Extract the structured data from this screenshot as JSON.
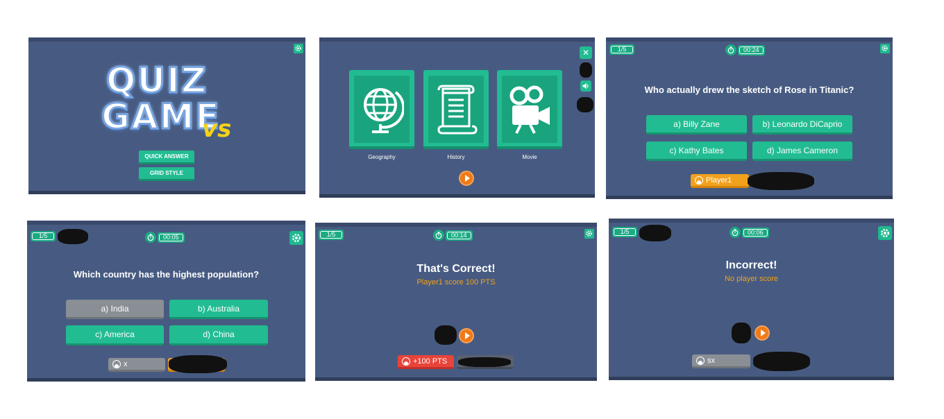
{
  "title_screen": {
    "logo_line1": "QUIZ",
    "logo_line2": "GAME",
    "logo_vs": "vs",
    "quick_answer": "QUICK ANSWER",
    "grid_style": "GRID STYLE"
  },
  "category_screen": {
    "categories": [
      {
        "label": "Geography",
        "icon": "globe-icon"
      },
      {
        "label": "History",
        "icon": "scroll-icon"
      },
      {
        "label": "Movie",
        "icon": "movie-camera-icon"
      }
    ],
    "close_label": "✕"
  },
  "question_screen_1": {
    "progress": "1/5",
    "timer": "00:24",
    "question": "Who actually drew the sketch of Rose in Titanic?",
    "answers": [
      "a) Billy Zane",
      "b) Leonardo DiCaprio",
      "c) Kathy Bates",
      "d) James Cameron"
    ],
    "player": "Player1"
  },
  "question_screen_2": {
    "progress": "1/5",
    "timer": "00:05",
    "question": "Which country has the highest population?",
    "answers": [
      "a) India",
      "b) Australia",
      "c) America",
      "d) China"
    ],
    "player": "x"
  },
  "correct_screen": {
    "progress": "1/5",
    "timer": "00:14",
    "title": "That's Correct!",
    "subtitle": "Player1 score 100 PTS",
    "points": "+100 PTS"
  },
  "incorrect_screen": {
    "progress": "1/5",
    "timer": "00:06",
    "title": "Incorrect!",
    "subtitle": "No player score",
    "player": "sx"
  },
  "colors": {
    "panel_bg": "#475b82",
    "accent_green": "#22bc92",
    "accent_orange": "#f2a11c",
    "accent_red": "#e8443a"
  }
}
